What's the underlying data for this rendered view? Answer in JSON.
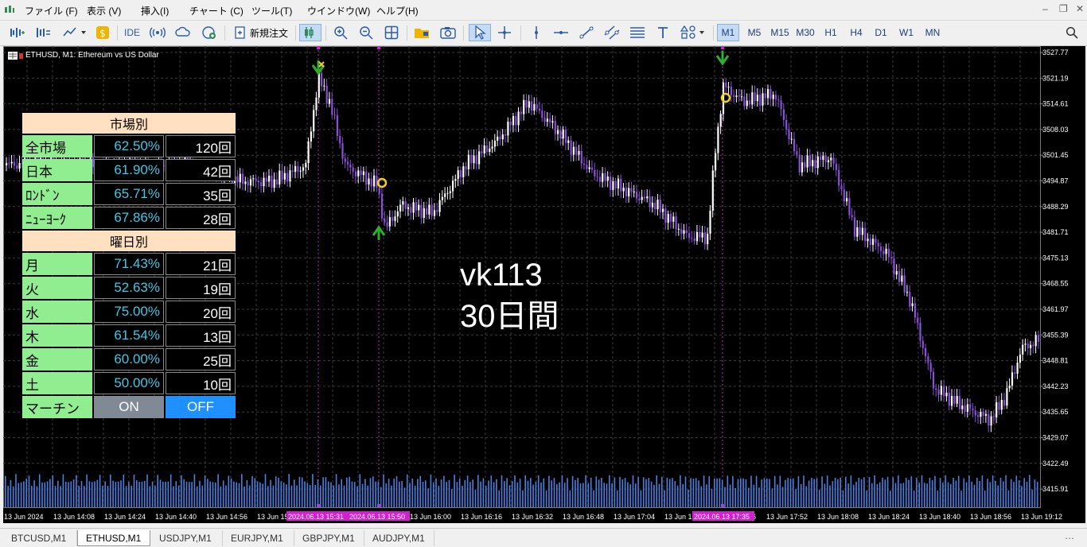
{
  "menu": {
    "items": [
      "ファイル (F)",
      "表示 (V)",
      "挿入(I)",
      "チャート (C)",
      "ツール(T)",
      "ウインドウ(W)",
      "ヘルプ(H)"
    ]
  },
  "toolbar": {
    "ide_label": "IDE",
    "new_order_label": "新規注文",
    "timeframes": [
      "M1",
      "M5",
      "M15",
      "M30",
      "H1",
      "H4",
      "D1",
      "W1",
      "MN"
    ],
    "active_timeframe": "M1"
  },
  "chart": {
    "title": "ETHUSD, M1:  Ethereum vs US Dollar",
    "price_labels": [
      "3527.77",
      "3521.19",
      "3514.61",
      "3508.03",
      "3501.45",
      "3494.87",
      "3488.29",
      "3481.71",
      "3475.13",
      "3468.55",
      "3461.97",
      "3455.39",
      "3448.81",
      "3442.23",
      "3435.65",
      "3429.07",
      "3422.49",
      "3415.91"
    ],
    "time_labels": [
      "13 Jun 2024",
      "13 Jun 14:08",
      "13 Jun 14:24",
      "13 Jun 14:40",
      "13 Jun 14:56",
      "13 Jun 15",
      "13 Jun 16:00",
      "13 Jun 16:16",
      "13 Jun 16:32",
      "13 Jun 16:48",
      "13 Jun 17:04",
      "13 Jun 1",
      "6",
      "13 Jun 17:52",
      "13 Jun 18:08",
      "13 Jun 18:24",
      "13 Jun 18:40",
      "13 Jun 18:56",
      "13 Jun 19:12"
    ],
    "highlight_time_labels": [
      "2024.06.13 15:31",
      "2024.06.13 15:50",
      "2024.06.13 17:35"
    ],
    "overlay_line1": "vk113",
    "overlay_line2": "30日間",
    "colors": {
      "background": "#000000",
      "grid": "#3a3a3a",
      "up": "#ffffff",
      "down": "#8a4fd8",
      "volume": "#4a7fe0",
      "marker": "#d020d0",
      "signal_up": "#2eae2e",
      "circle": "#f0d020"
    }
  },
  "stats": {
    "market_header": "市場別",
    "market_rows": [
      {
        "label": "全市場",
        "pct": "62.50%",
        "count": "120回"
      },
      {
        "label": "日本",
        "pct": "61.90%",
        "count": "42回"
      },
      {
        "label": "ﾛﾝﾄﾞﾝ",
        "pct": "65.71%",
        "count": "35回"
      },
      {
        "label": "ﾆｭｰﾖｰｸ",
        "pct": "67.86%",
        "count": "28回"
      }
    ],
    "weekday_header": "曜日別",
    "weekday_rows": [
      {
        "label": "月",
        "pct": "71.43%",
        "count": "21回"
      },
      {
        "label": "火",
        "pct": "52.63%",
        "count": "19回"
      },
      {
        "label": "水",
        "pct": "75.00%",
        "count": "20回"
      },
      {
        "label": "木",
        "pct": "61.54%",
        "count": "13回"
      },
      {
        "label": "金",
        "pct": "60.00%",
        "count": "25回"
      },
      {
        "label": "土",
        "pct": "50.00%",
        "count": "10回"
      }
    ],
    "martingale_label": "マーチン",
    "on_label": "ON",
    "off_label": "OFF"
  },
  "tabs": [
    "BTCUSD,M1",
    "ETHUSD,M1",
    "USDJPY,M1",
    "EURJPY,M1",
    "GBPJPY,M1",
    "AUDJPY,M1"
  ],
  "active_tab": "ETHUSD,M1"
}
